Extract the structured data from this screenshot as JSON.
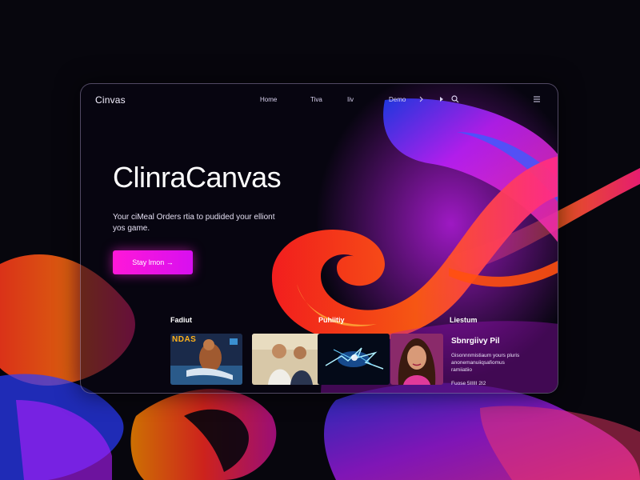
{
  "app": {
    "logo": "Cinvas"
  },
  "nav": {
    "links": [
      "Home",
      "Tiva",
      "Iiv",
      "Demo"
    ],
    "icons": [
      "chevron-icon",
      "play-icon",
      "search-icon",
      "menu-icon"
    ]
  },
  "hero": {
    "title": "ClinraCanvas",
    "subtitle": "Your ciMeal Orders rtia to pudided your elliont yos game.",
    "cta_label": "Stay lmon →"
  },
  "sections": {
    "left_label": "Fadiut",
    "middle_label": "Puhiitiy",
    "right_label": "Liestum"
  },
  "thumbs": {
    "first_overlay": "NDAS"
  },
  "featured": {
    "title": "Sbnrgiivy Pil",
    "description": "Gisonnnmistiaum yours pluris anonemanuiiqsafiomus ramiiatiio",
    "meta": "Fuose 5IIIII 2I2"
  },
  "colors": {
    "accent": "#ff18d8",
    "background": "#07060d"
  }
}
